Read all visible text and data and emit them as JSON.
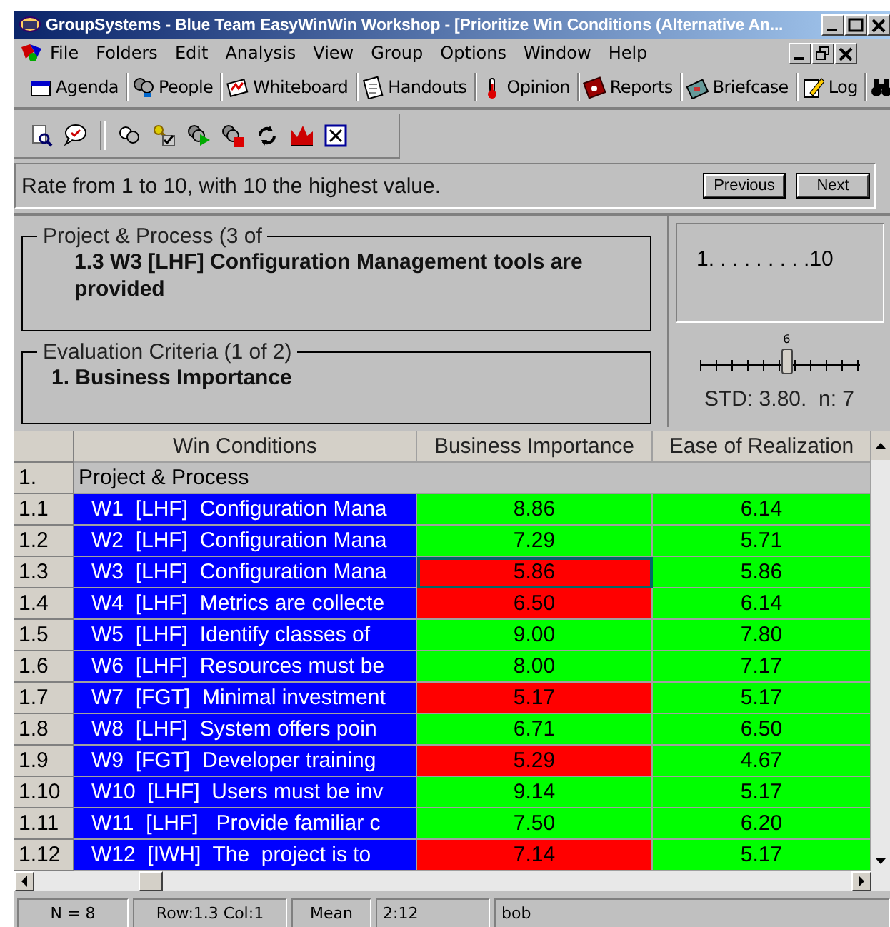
{
  "window": {
    "title": "GroupSystems - Blue Team EasyWinWin Workshop - [Prioritize Win Conditions (Alternative An..."
  },
  "menu": [
    "File",
    "Folders",
    "Edit",
    "Analysis",
    "View",
    "Group",
    "Options",
    "Window",
    "Help"
  ],
  "toolbar": [
    "Agenda",
    "People",
    "Whiteboard",
    "Handouts",
    "Opinion",
    "Reports",
    "Briefcase",
    "Log"
  ],
  "prompt": {
    "text": "Rate from 1 to 10, with 10 the highest value.",
    "buttons": [
      "Previous",
      "Next"
    ]
  },
  "topic": {
    "legend": "Project & Process (3 of",
    "text": "1.3 W3  [LHF]  Configuration Management tools are provided"
  },
  "criteria": {
    "legend": "Evaluation Criteria (1 of 2)",
    "text": "1. Business Importance"
  },
  "scale": {
    "range": "1. . . . . . . . .10",
    "slider": {
      "level": 0.55,
      "thumb_label": "6"
    },
    "stats": "STD: 3.80.  n: 7"
  },
  "table": {
    "columns": [
      "Win Conditions",
      "Business Importance",
      "Ease of Realization"
    ],
    "rows": [
      {
        "kind": "group",
        "number": "1.",
        "title": "Project & Process"
      },
      {
        "kind": "item",
        "number": "1.1",
        "title": "W1  [LHF]  Configuration Mana",
        "scores": [
          {
            "value": "8.86",
            "color": "#00ff00",
            "selected": false
          },
          {
            "value": "6.14",
            "color": "#00ff00",
            "selected": false
          }
        ]
      },
      {
        "kind": "item",
        "number": "1.2",
        "title": "W2  [LHF]  Configuration Mana",
        "scores": [
          {
            "value": "7.29",
            "color": "#00ff00",
            "selected": false
          },
          {
            "value": "5.71",
            "color": "#00ff00",
            "selected": false
          }
        ]
      },
      {
        "kind": "item",
        "number": "1.3",
        "title": "W3  [LHF]  Configuration Mana",
        "scores": [
          {
            "value": "5.86",
            "color": "#ff0000",
            "selected": true
          },
          {
            "value": "5.86",
            "color": "#00ff00",
            "selected": false
          }
        ]
      },
      {
        "kind": "item",
        "number": "1.4",
        "title": "W4  [LHF]  Metrics are collecte",
        "scores": [
          {
            "value": "6.50",
            "color": "#ff0000",
            "selected": false
          },
          {
            "value": "6.14",
            "color": "#00ff00",
            "selected": false
          }
        ]
      },
      {
        "kind": "item",
        "number": "1.5",
        "title": "W5  [LHF]  Identify classes of",
        "scores": [
          {
            "value": "9.00",
            "color": "#00ff00",
            "selected": false
          },
          {
            "value": "7.80",
            "color": "#00ff00",
            "selected": false
          }
        ]
      },
      {
        "kind": "item",
        "number": "1.6",
        "title": "W6  [LHF]  Resources must be",
        "scores": [
          {
            "value": "8.00",
            "color": "#00ff00",
            "selected": false
          },
          {
            "value": "7.17",
            "color": "#00ff00",
            "selected": false
          }
        ]
      },
      {
        "kind": "item",
        "number": "1.7",
        "title": "W7  [FGT]  Minimal investment",
        "scores": [
          {
            "value": "5.17",
            "color": "#ff0000",
            "selected": false
          },
          {
            "value": "5.17",
            "color": "#00ff00",
            "selected": false
          }
        ]
      },
      {
        "kind": "item",
        "number": "1.8",
        "title": "W8  [LHF]  System offers poin",
        "scores": [
          {
            "value": "6.71",
            "color": "#00ff00",
            "selected": false
          },
          {
            "value": "6.50",
            "color": "#00ff00",
            "selected": false
          }
        ]
      },
      {
        "kind": "item",
        "number": "1.9",
        "title": "W9  [FGT]  Developer training",
        "scores": [
          {
            "value": "5.29",
            "color": "#ff0000",
            "selected": false
          },
          {
            "value": "4.67",
            "color": "#00ff00",
            "selected": false
          }
        ]
      },
      {
        "kind": "item",
        "number": "1.10",
        "title": "W10  [LHF]  Users must be inv",
        "scores": [
          {
            "value": "9.14",
            "color": "#00ff00",
            "selected": false
          },
          {
            "value": "5.17",
            "color": "#00ff00",
            "selected": false
          }
        ]
      },
      {
        "kind": "item",
        "number": "1.11",
        "title": "W11  [LHF]   Provide familiar c",
        "scores": [
          {
            "value": "7.50",
            "color": "#00ff00",
            "selected": false
          },
          {
            "value": "6.20",
            "color": "#00ff00",
            "selected": false
          }
        ]
      },
      {
        "kind": "item",
        "number": "1.12",
        "title": "W12  [IWH]  The  project is to",
        "scores": [
          {
            "value": "7.14",
            "color": "#ff0000",
            "selected": false
          },
          {
            "value": "5.17",
            "color": "#00ff00",
            "selected": false
          }
        ]
      }
    ]
  },
  "status_bar": [
    "N = 8",
    "Row:1.3 Col:1",
    "Mean",
    "2:12",
    "bob"
  ]
}
